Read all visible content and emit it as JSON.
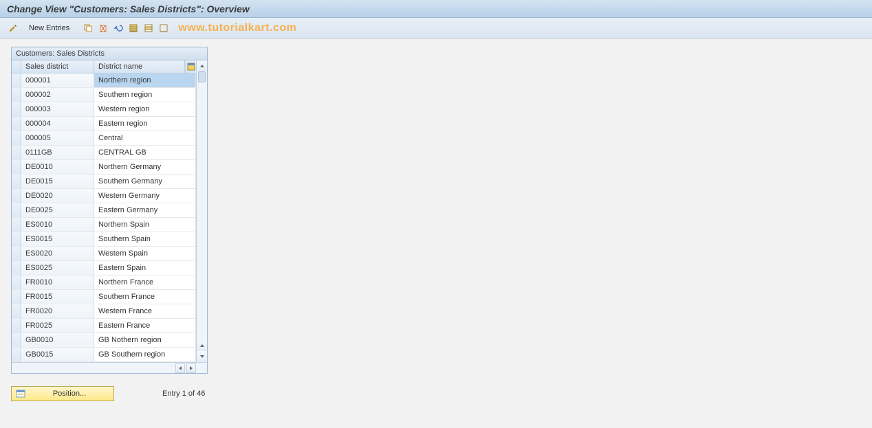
{
  "header": {
    "title": "Change View \"Customers: Sales Districts\": Overview"
  },
  "toolbar": {
    "new_entries_label": "New Entries",
    "watermark": "www.tutorialkart.com",
    "icons": {
      "pencil": "pencil-icon",
      "copy": "copy-icon",
      "delete": "delete-icon",
      "undo": "undo-icon",
      "select_all": "select-all-icon",
      "select_block": "select-block-icon",
      "deselect_all": "deselect-all-icon"
    }
  },
  "table": {
    "title": "Customers: Sales Districts",
    "columns": {
      "code": "Sales district",
      "name": "District name"
    },
    "config_icon": "table-settings-icon",
    "rows": [
      {
        "code": "000001",
        "name": "Northern region",
        "selected": true
      },
      {
        "code": "000002",
        "name": "Southern region"
      },
      {
        "code": "000003",
        "name": "Western region"
      },
      {
        "code": "000004",
        "name": "Eastern region"
      },
      {
        "code": "000005",
        "name": "Central"
      },
      {
        "code": "0111GB",
        "name": "CENTRAL GB"
      },
      {
        "code": "DE0010",
        "name": "Northern Germany"
      },
      {
        "code": "DE0015",
        "name": "Southern Germany"
      },
      {
        "code": "DE0020",
        "name": "Western Germany"
      },
      {
        "code": "DE0025",
        "name": "Eastern Germany"
      },
      {
        "code": "ES0010",
        "name": "Northern Spain"
      },
      {
        "code": "ES0015",
        "name": "Southern Spain"
      },
      {
        "code": "ES0020",
        "name": "Western Spain"
      },
      {
        "code": "ES0025",
        "name": "Eastern Spain"
      },
      {
        "code": "FR0010",
        "name": "Northern France"
      },
      {
        "code": "FR0015",
        "name": "Southern France"
      },
      {
        "code": "FR0020",
        "name": "Western France"
      },
      {
        "code": "FR0025",
        "name": "Eastern France"
      },
      {
        "code": "GB0010",
        "name": "GB Nothern region"
      },
      {
        "code": "GB0015",
        "name": "GB Southern region"
      }
    ]
  },
  "footer": {
    "position_label": "Position...",
    "entry_text": "Entry 1 of 46"
  }
}
